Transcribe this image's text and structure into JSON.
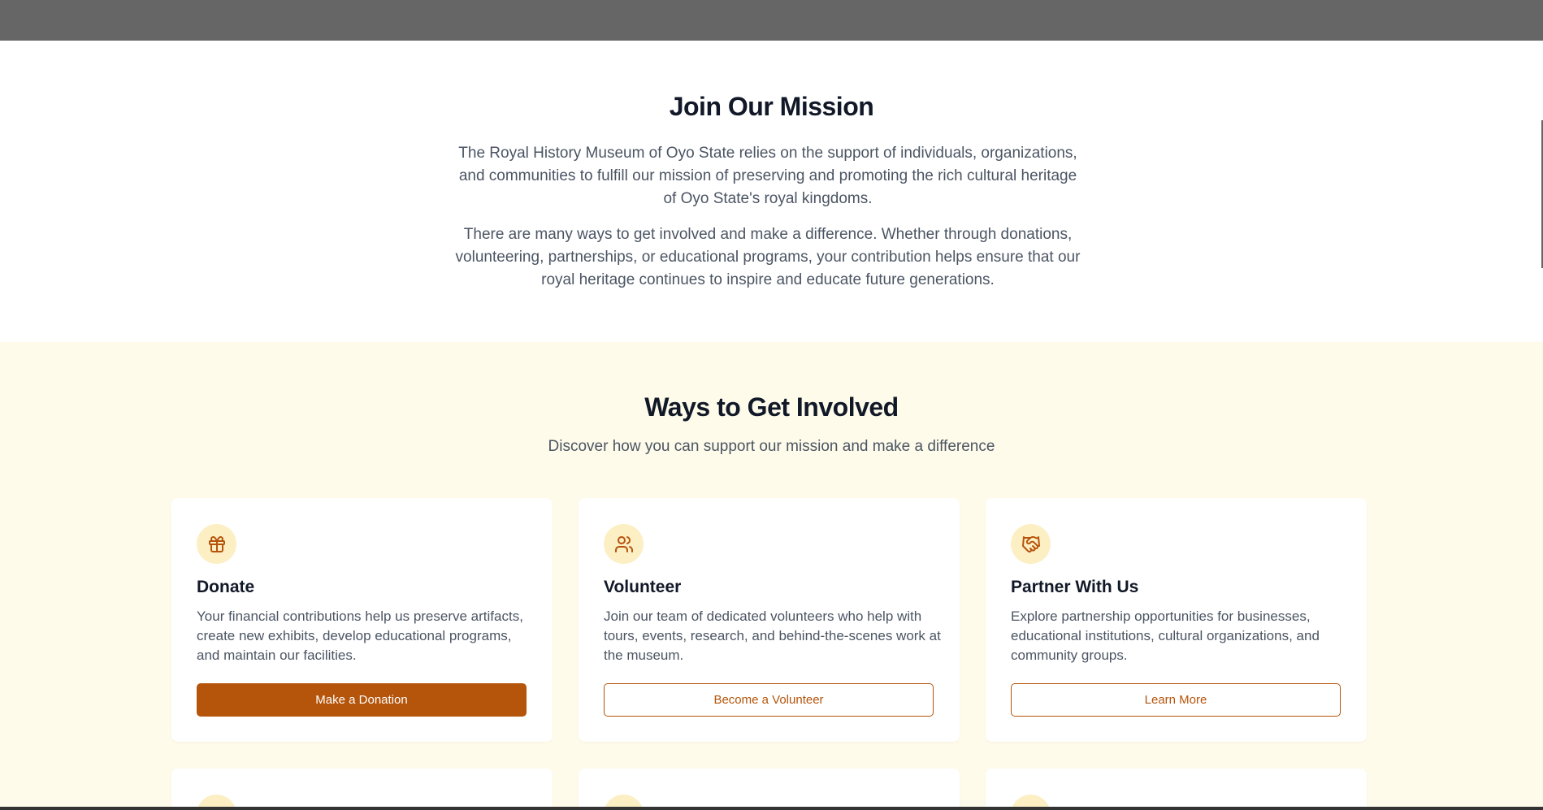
{
  "mission": {
    "title": "Join Our Mission",
    "paragraph1": "The Royal History Museum of Oyo State relies on the support of individuals, organizations, and communities to fulfill our mission of preserving and promoting the rich cultural heritage of Oyo State's royal kingdoms.",
    "paragraph2": "There are many ways to get involved and make a difference. Whether through donations, volunteering, partnerships, or educational programs, your contribution helps ensure that our royal heritage continues to inspire and educate future generations."
  },
  "involved": {
    "title": "Ways to Get Involved",
    "subtitle": "Discover how you can support our mission and make a difference",
    "cards": [
      {
        "icon": "gift-icon",
        "title": "Donate",
        "description": "Your financial contributions help us preserve artifacts, create new exhibits, develop educational programs, and maintain our facilities.",
        "button": "Make a Donation"
      },
      {
        "icon": "users-icon",
        "title": "Volunteer",
        "description": "Join our team of dedicated volunteers who help with tours, events, research, and behind-the-scenes work at the museum.",
        "button": "Become a Volunteer"
      },
      {
        "icon": "handshake-icon",
        "title": "Partner With Us",
        "description": "Explore partnership opportunities for businesses, educational institutions, cultural organizations, and community groups.",
        "button": "Learn More"
      }
    ]
  },
  "colors": {
    "accent": "#b5540b",
    "icon_bg": "#fdefc4",
    "section_bg": "#fefbea",
    "topbar": "#666666"
  }
}
